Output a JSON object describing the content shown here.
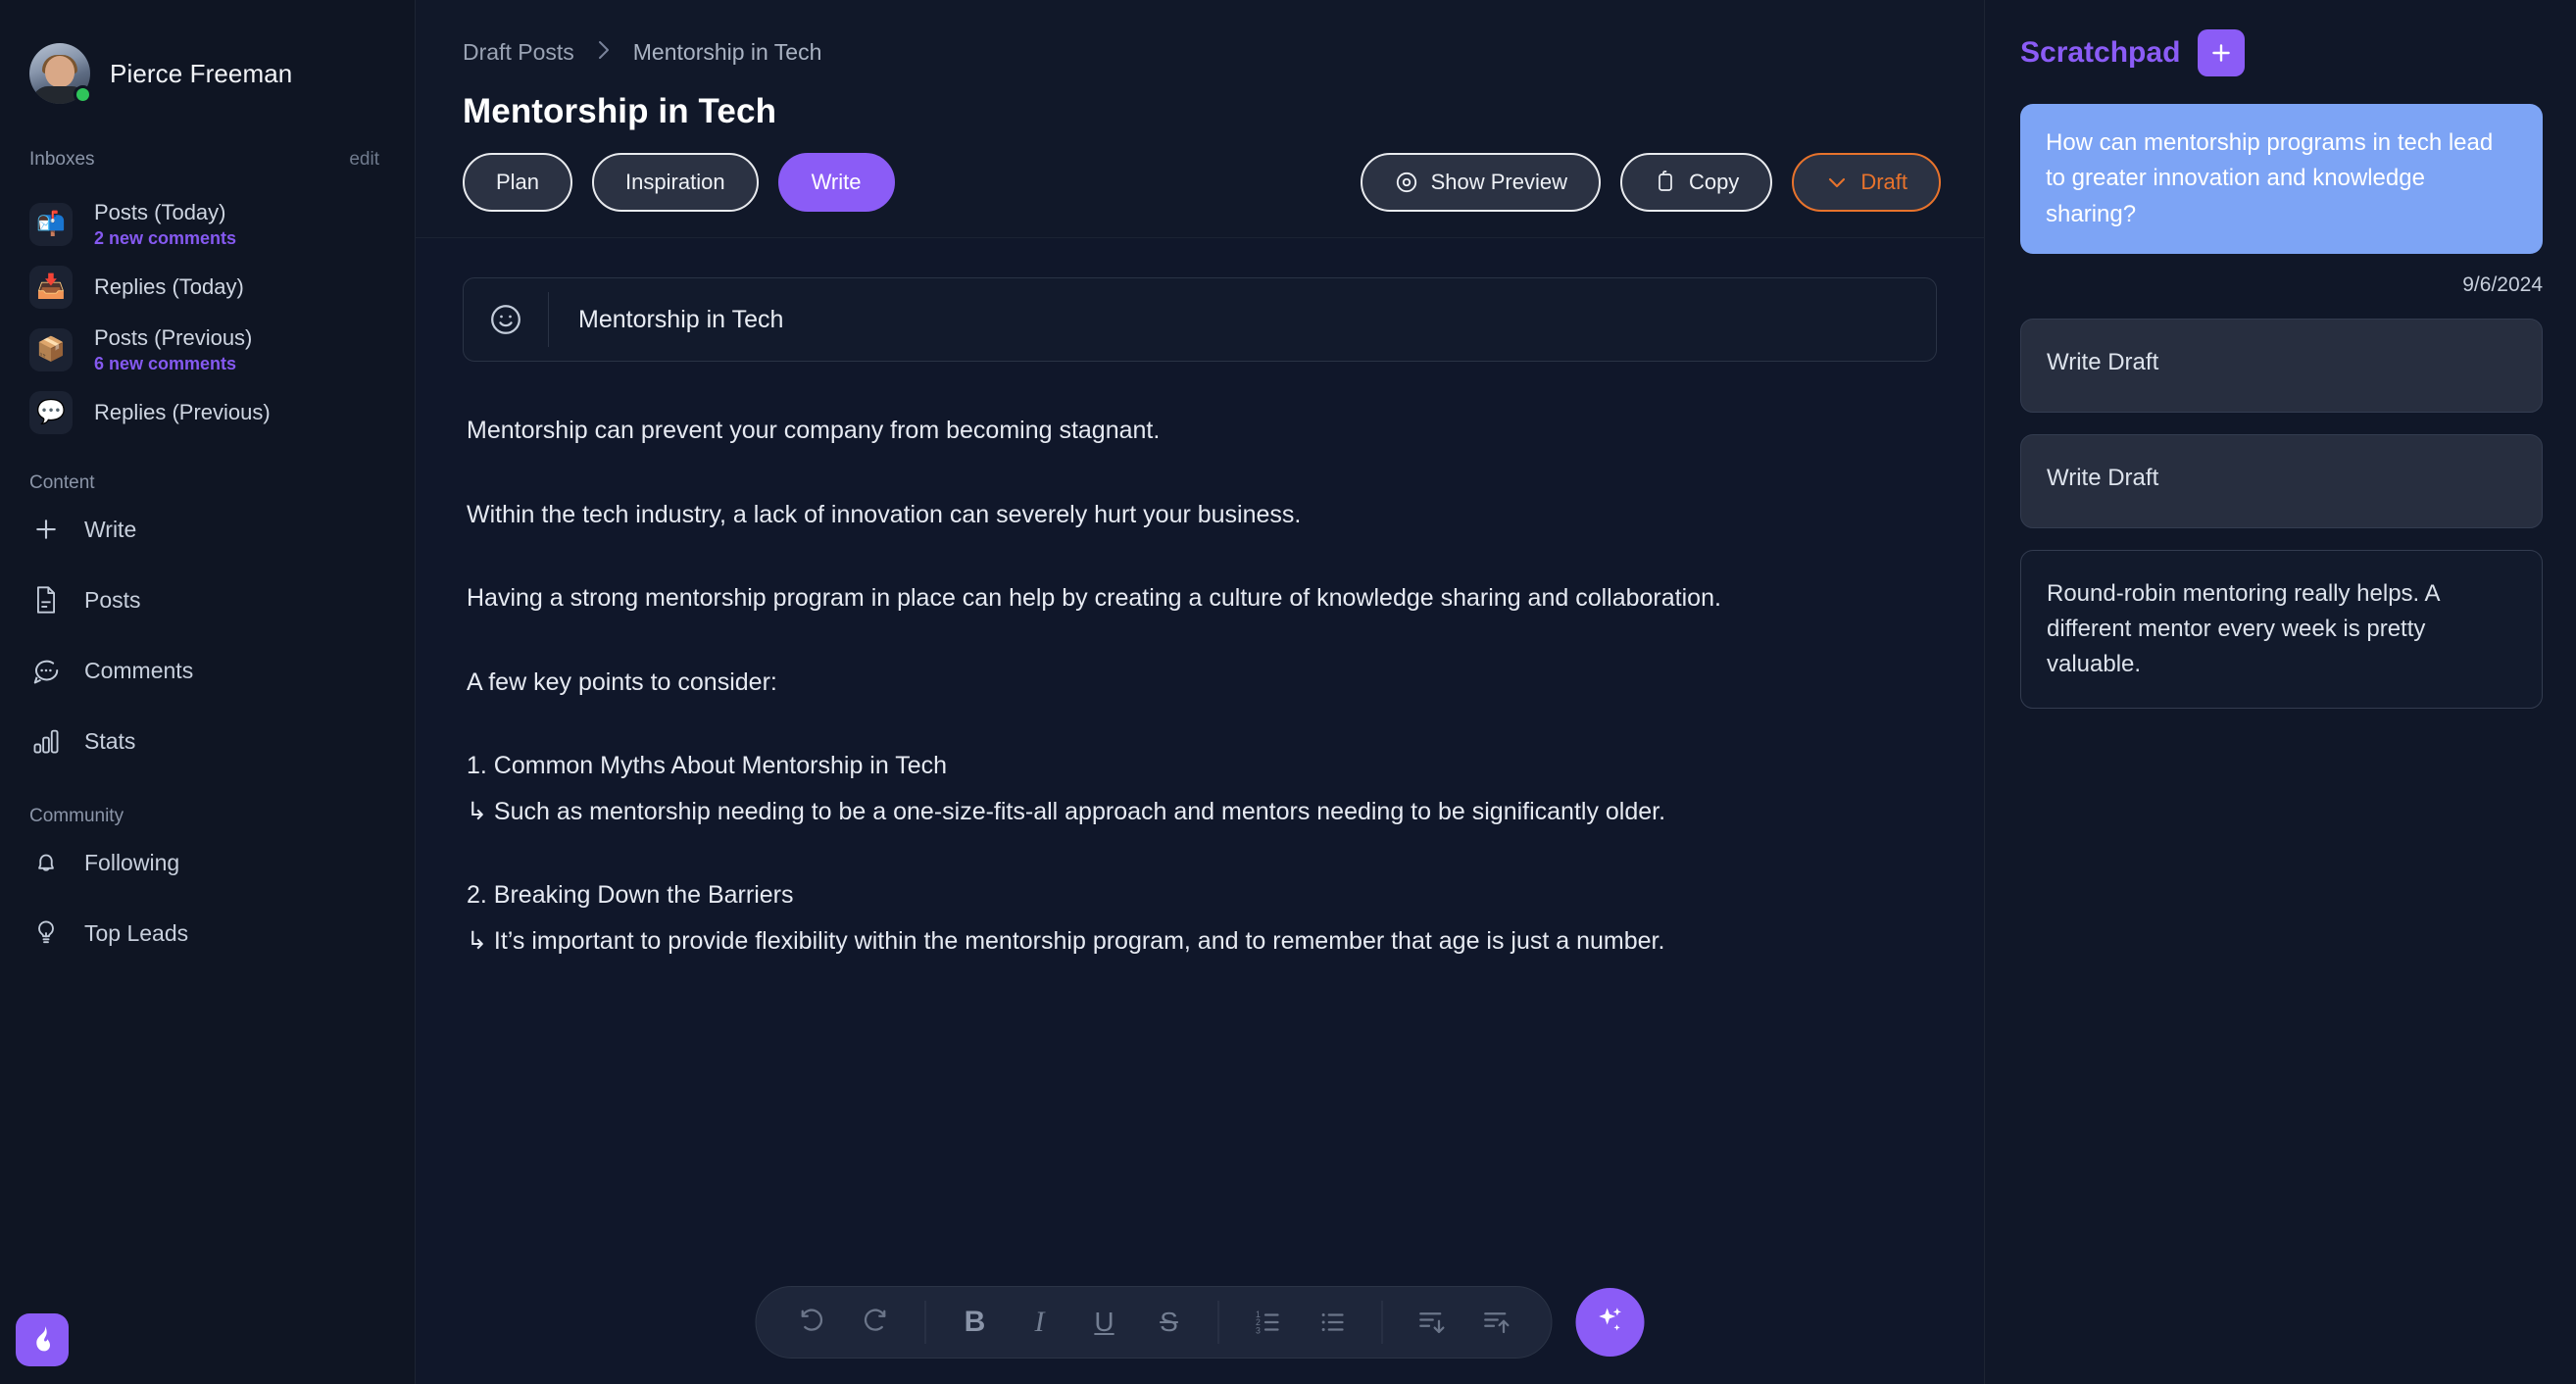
{
  "sidebar": {
    "user": {
      "name": "Pierce Freeman",
      "status": "online"
    },
    "inboxes_head": {
      "title": "Inboxes",
      "edit_label": "edit"
    },
    "inboxes": [
      {
        "icon": "mailbox-icon",
        "glyph": "📬",
        "label": "Posts (Today)",
        "sub": "2 new comments"
      },
      {
        "icon": "inbox-tray-icon",
        "glyph": "📥",
        "label": "Replies (Today)",
        "sub": ""
      },
      {
        "icon": "package-icon",
        "glyph": "📦",
        "label": "Posts (Previous)",
        "sub": "6 new comments"
      },
      {
        "icon": "speech-balloon-icon",
        "glyph": "💬",
        "label": "Replies (Previous)",
        "sub": ""
      }
    ],
    "content_head": "Content",
    "content_items": [
      {
        "icon": "plus-icon",
        "label": "Write"
      },
      {
        "icon": "document-icon",
        "label": "Posts"
      },
      {
        "icon": "comment-icon",
        "label": "Comments"
      },
      {
        "icon": "bar-chart-icon",
        "label": "Stats"
      }
    ],
    "community_head": "Community",
    "community_items": [
      {
        "icon": "bell-icon",
        "label": "Following"
      },
      {
        "icon": "lightbulb-icon",
        "label": "Top Leads"
      }
    ],
    "brand": {
      "icon": "flame-logo-icon",
      "color": "#8b5cf6"
    }
  },
  "main": {
    "breadcrumb": {
      "root": "Draft Posts",
      "separator": "›",
      "current": "Mentorship in Tech"
    },
    "page_title": "Mentorship in Tech",
    "tabs": [
      {
        "label": "Plan",
        "active": false
      },
      {
        "label": "Inspiration",
        "active": false
      },
      {
        "label": "Write",
        "active": true
      }
    ],
    "actions": [
      {
        "label": "Show Preview",
        "icon": "eye-icon",
        "style": "outline"
      },
      {
        "label": "Copy",
        "icon": "clipboard-icon",
        "style": "outline"
      },
      {
        "label": "Draft",
        "icon": "chevron-down-icon",
        "style": "draft"
      }
    ],
    "editor": {
      "emoji_button": "smiley-icon",
      "doc_title": "Mentorship in Tech",
      "paragraphs": [
        {
          "text": "Mentorship can prevent your company from becoming stagnant.",
          "type": "body"
        },
        {
          "text": "Within the tech industry, a lack of innovation can severely hurt your business.",
          "type": "body"
        },
        {
          "text": "Having a strong mentorship program in place can help by creating a culture of knowledge sharing and collaboration.",
          "type": "body"
        },
        {
          "text": "A few key points to consider:",
          "type": "body"
        },
        {
          "text": "1. Common Myths About Mentorship in Tech",
          "type": "heading"
        },
        {
          "text": "↳ Such as mentorship needing to be a one-size-fits-all approach and mentors needing to be significantly older.",
          "type": "sub"
        },
        {
          "text": "2. Breaking Down the Barriers",
          "type": "heading"
        },
        {
          "text": "↳ It’s important to provide flexibility within the mentorship program, and to remember that age is just a number.",
          "type": "sub"
        }
      ]
    },
    "format_toolbar": {
      "buttons": [
        {
          "icon": "undo-icon",
          "label": "↶"
        },
        {
          "icon": "redo-icon",
          "label": "↷"
        },
        {
          "icon": "bold-icon",
          "label": "B"
        },
        {
          "icon": "italic-icon",
          "label": "I"
        },
        {
          "icon": "underline-icon",
          "label": "U"
        },
        {
          "icon": "strikethrough-icon",
          "label": "S"
        },
        {
          "icon": "ordered-list-icon",
          "label": ""
        },
        {
          "icon": "bullet-list-icon",
          "label": ""
        },
        {
          "icon": "insert-below-icon",
          "label": ""
        },
        {
          "icon": "insert-above-icon",
          "label": ""
        }
      ],
      "ai_button": {
        "icon": "sparkles-icon",
        "color": "#8b5cf6"
      }
    }
  },
  "scratchpad": {
    "title": "Scratchpad",
    "add_button": "plus-icon",
    "highlight_note": "How can mentorship programs in tech lead to greater innovation and knowledge sharing?",
    "date": "9/6/2024",
    "notes": [
      {
        "text": "Write Draft",
        "variant": "filled"
      },
      {
        "text": "Write Draft",
        "variant": "filled"
      },
      {
        "text": "Round-robin mentoring really helps. A different mentor every week is pretty valuable.",
        "variant": "plain"
      }
    ]
  },
  "colors": {
    "accent": "#8b5cf6",
    "draft": "#e8732c",
    "highlight": "#7da4f5",
    "online": "#2fc45a"
  }
}
